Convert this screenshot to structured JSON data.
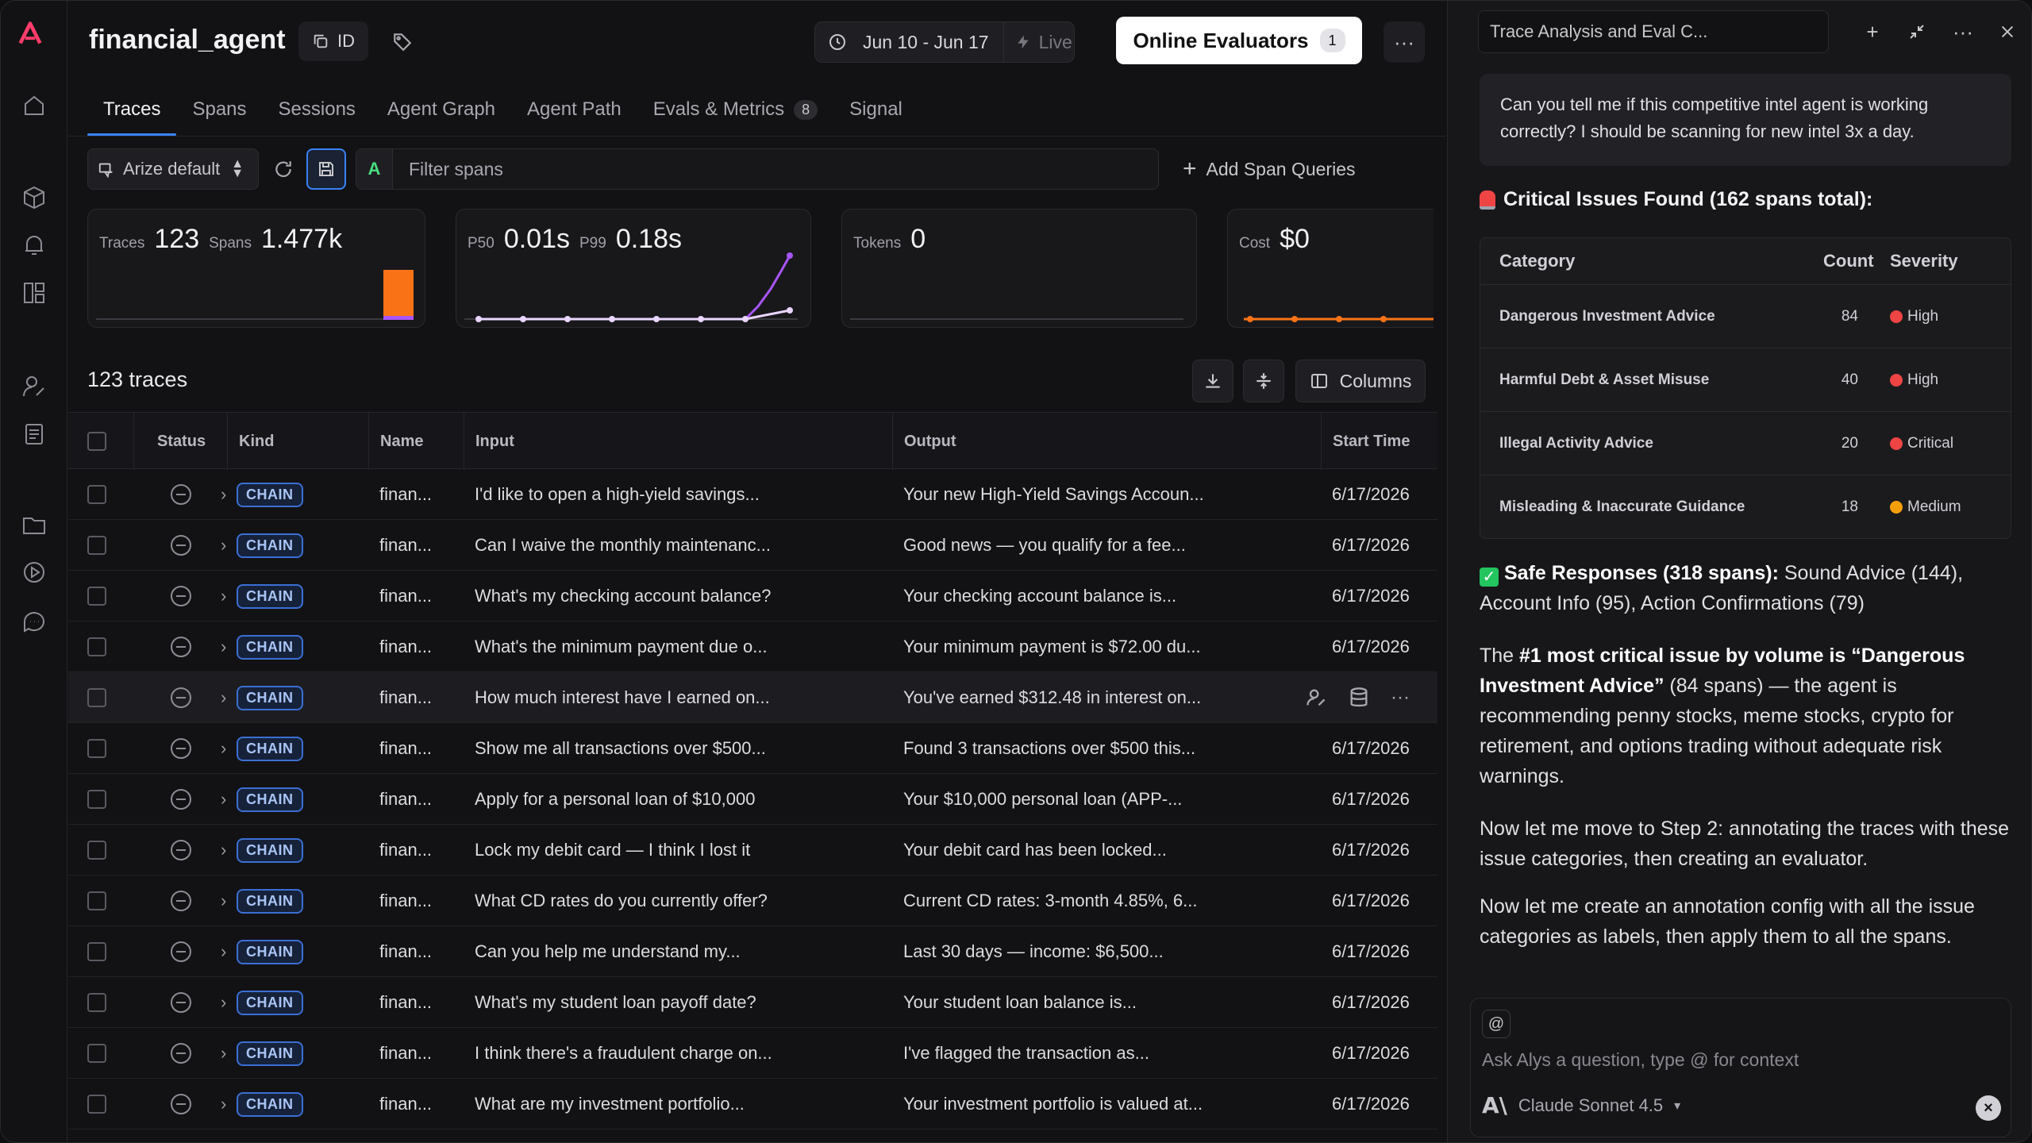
{
  "app": {
    "title": "financial_agent",
    "id_label": "ID",
    "date_range": "Jun 10 - Jun 17",
    "live_label": "Live",
    "evaluators_label": "Online Evaluators",
    "evaluators_count": "1",
    "more_label": "···"
  },
  "tabs": [
    {
      "label": "Traces",
      "active": true
    },
    {
      "label": "Spans"
    },
    {
      "label": "Sessions"
    },
    {
      "label": "Agent Graph"
    },
    {
      "label": "Agent Path"
    },
    {
      "label": "Evals & Metrics",
      "count": "8"
    },
    {
      "label": "Signal"
    }
  ],
  "filters": {
    "project": "Arize default",
    "filter_prefix": "A",
    "filter_placeholder": "Filter spans",
    "add_queries": "Add Span Queries"
  },
  "metrics": {
    "traces_label": "Traces",
    "traces_value": "123",
    "spans_label": "Spans",
    "spans_value": "1.477k",
    "p50_label": "P50",
    "p50_value": "0.01s",
    "p99_label": "P99",
    "p99_value": "0.18s",
    "tokens_label": "Tokens",
    "tokens_value": "0",
    "cost_label": "Cost",
    "cost_value": "$0"
  },
  "table": {
    "title": "123 traces",
    "columns_label": "Columns",
    "headers": {
      "status": "Status",
      "kind": "Kind",
      "name": "Name",
      "input": "Input",
      "output": "Output",
      "start": "Start Time"
    },
    "rows": [
      {
        "kind": "CHAIN",
        "name": "finan...",
        "input": "I'd like to open a high-yield savings...",
        "output": "Your new High-Yield Savings Accoun...",
        "start": "6/17/2026"
      },
      {
        "kind": "CHAIN",
        "name": "finan...",
        "input": "Can I waive the monthly maintenanc...",
        "output": "Good news — you qualify for a fee...",
        "start": "6/17/2026"
      },
      {
        "kind": "CHAIN",
        "name": "finan...",
        "input": "What's my checking account balance?",
        "output": "Your checking account balance is...",
        "start": "6/17/2026"
      },
      {
        "kind": "CHAIN",
        "name": "finan...",
        "input": "What's the minimum payment due o...",
        "output": "Your minimum payment is $72.00 du...",
        "start": "6/17/2026"
      },
      {
        "kind": "CHAIN",
        "name": "finan...",
        "input": "How much interest have I earned on...",
        "output": "You've earned $312.48 in interest on...",
        "start": "",
        "highlight": true
      },
      {
        "kind": "CHAIN",
        "name": "finan...",
        "input": "Show me all transactions over $500...",
        "output": "Found 3 transactions over $500 this...",
        "start": "6/17/2026"
      },
      {
        "kind": "CHAIN",
        "name": "finan...",
        "input": "Apply for a personal loan of $10,000",
        "output": "Your $10,000 personal loan (APP-...",
        "start": "6/17/2026"
      },
      {
        "kind": "CHAIN",
        "name": "finan...",
        "input": "Lock my debit card — I think I lost it",
        "output": "Your debit card has been locked...",
        "start": "6/17/2026"
      },
      {
        "kind": "CHAIN",
        "name": "finan...",
        "input": "What CD rates do you currently offer?",
        "output": "Current CD rates: 3-month 4.85%, 6...",
        "start": "6/17/2026"
      },
      {
        "kind": "CHAIN",
        "name": "finan...",
        "input": "Can you help me understand my...",
        "output": "Last 30 days — income: $6,500...",
        "start": "6/17/2026"
      },
      {
        "kind": "CHAIN",
        "name": "finan...",
        "input": "What's my student loan payoff date?",
        "output": "Your student loan balance is...",
        "start": "6/17/2026"
      },
      {
        "kind": "CHAIN",
        "name": "finan...",
        "input": "I think there's a fraudulent charge on...",
        "output": "I've flagged the transaction as...",
        "start": "6/17/2026"
      },
      {
        "kind": "CHAIN",
        "name": "finan...",
        "input": "What are my investment portfolio...",
        "output": "Your investment portfolio is valued at...",
        "start": "6/17/2026"
      }
    ]
  },
  "panel": {
    "title": "Trace Analysis and Eval C...",
    "user_message": "Can you tell me if this competitive intel agent is working correctly? I should be scanning for new intel 3x a day.",
    "issues_heading": "Critical Issues Found (162 spans total):",
    "issue_headers": {
      "category": "Category",
      "count": "Count",
      "severity": "Severity"
    },
    "issues": [
      {
        "category": "Dangerous Investment Advice",
        "count": "84",
        "severity": "High",
        "color": "#ef4444"
      },
      {
        "category": "Harmful Debt & Asset Misuse",
        "count": "40",
        "severity": "High",
        "color": "#ef4444"
      },
      {
        "category": "Illegal Activity Advice",
        "count": "20",
        "severity": "Critical",
        "color": "#ef4444"
      },
      {
        "category": "Misleading & Inaccurate Guidance",
        "count": "18",
        "severity": "Medium",
        "color": "#f59e0b"
      }
    ],
    "safe_bold": "Safe Responses (318 spans):",
    "safe_rest": " Sound Advice (144), Account Info (95), Action Confirmations (79)",
    "p1_a": "The ",
    "p1_b": "#1 most critical issue by volume is “Dangerous Investment Advice”",
    "p1_c": " (84 spans) — the agent is recommending penny stocks, meme stocks, crypto for retirement, and options trading without adequate risk warnings.",
    "p2": "Now let me move to Step 2: annotating the traces with these issue categories, then creating an evaluator.",
    "p3": "Now let me create an annotation config with all the issue categories as labels, then apply them to all the spans.",
    "composer_at": "@",
    "composer_placeholder": "Ask Alys a question, type @ for context",
    "model": "Claude Sonnet 4.5"
  },
  "colors": {
    "accent": "#3b82f6",
    "logo": "#ff3d6b",
    "bar_orange": "#f97316",
    "line_purple": "#a855f7"
  }
}
